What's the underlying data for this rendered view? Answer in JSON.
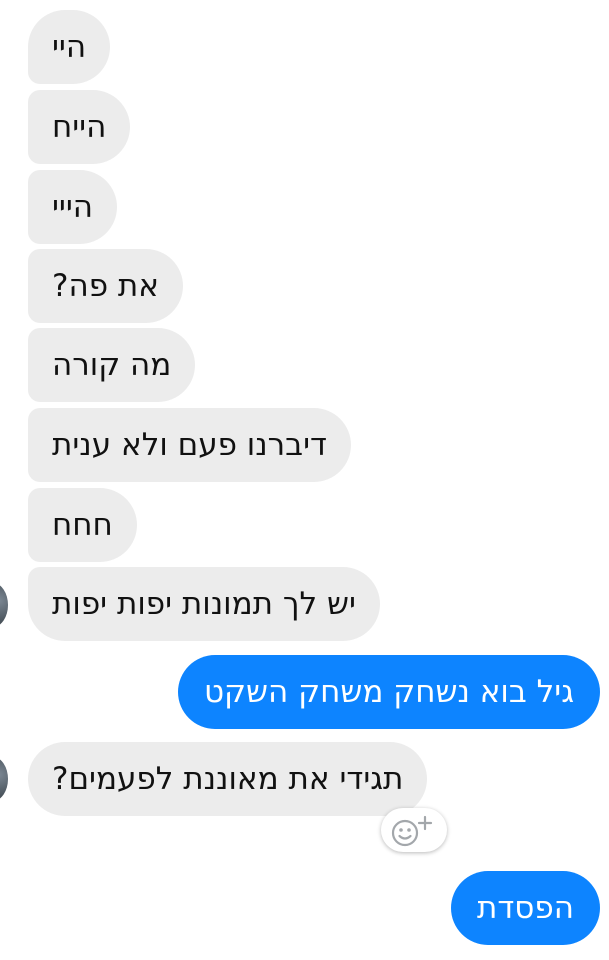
{
  "conversation": {
    "messages": [
      {
        "sender": "other",
        "text": "היי"
      },
      {
        "sender": "other",
        "text": "הייח"
      },
      {
        "sender": "other",
        "text": "הייי"
      },
      {
        "sender": "other",
        "text": "את פה?"
      },
      {
        "sender": "other",
        "text": "מה קורה"
      },
      {
        "sender": "other",
        "text": "דיברנו פעם ולא ענית"
      },
      {
        "sender": "other",
        "text": "חחח"
      },
      {
        "sender": "other",
        "text": "יש לך תמונות יפות יפות"
      },
      {
        "sender": "me",
        "text": "גיל בוא נשחק משחק השקט"
      },
      {
        "sender": "other",
        "text": "תגידי את מאוננת לפעמים?"
      },
      {
        "sender": "me",
        "text": "הפסדת"
      }
    ]
  },
  "icons": {
    "avatar": "avatar",
    "add_reaction": "smiley-plus-icon"
  },
  "colors": {
    "incoming_bubble": "#ececec",
    "outgoing_bubble": "#0d84ff",
    "incoming_text": "#111111",
    "outgoing_text": "#ffffff"
  }
}
